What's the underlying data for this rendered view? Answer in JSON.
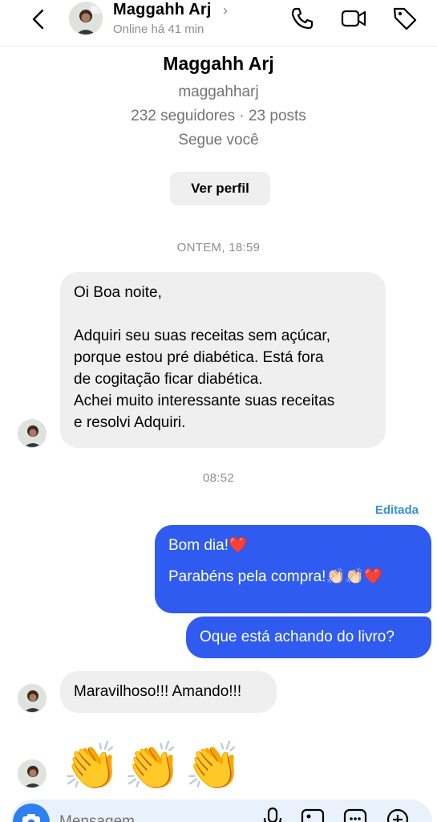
{
  "header": {
    "name": "Maggahh Arj",
    "chevron": "›",
    "status": "Online há 41 min",
    "icons": [
      "back-arrow-icon",
      "phone-icon",
      "video-camera-icon",
      "tag-icon"
    ]
  },
  "profile": {
    "name": "Maggahh Arj",
    "handle": "maggahharj",
    "stats": "232 seguidores · 23 posts",
    "follows": "Segue você",
    "button": "Ver perfil"
  },
  "timestamps": {
    "first": "ONTEM, 18:59",
    "second": "08:52"
  },
  "messages": {
    "in1": {
      "line1": "Oi Boa noite,",
      "line2": "Adquiri seu suas receitas sem açúcar,",
      "line3": "porque estou pré diabética. Está fora",
      "line4": "de cogitação ficar diabética.",
      "line5": "Achei muito interessante suas receitas",
      "line6": "e resolvi Adquiri."
    },
    "edited_label": "Editada",
    "out1": {
      "line1": "Bom dia!❤️",
      "line2": "Parabéns pela compra!👏🏻👏🏻❤️"
    },
    "out2": "Oque está achando do livro?",
    "in2": "Maravilhoso!!! Amando!!!",
    "in3_emojis": [
      "👏",
      "👏",
      "👏"
    ]
  },
  "composer": {
    "placeholder": "Mensagem...",
    "icons": [
      "camera-icon",
      "microphone-icon",
      "image-icon",
      "sticker-icon",
      "plus-icon"
    ]
  },
  "colors": {
    "outgoing_bubble": "#2f5bf0",
    "incoming_bubble": "#efefef",
    "edited_label": "#3b8fd6",
    "camera_button": "#2e7ff0"
  }
}
